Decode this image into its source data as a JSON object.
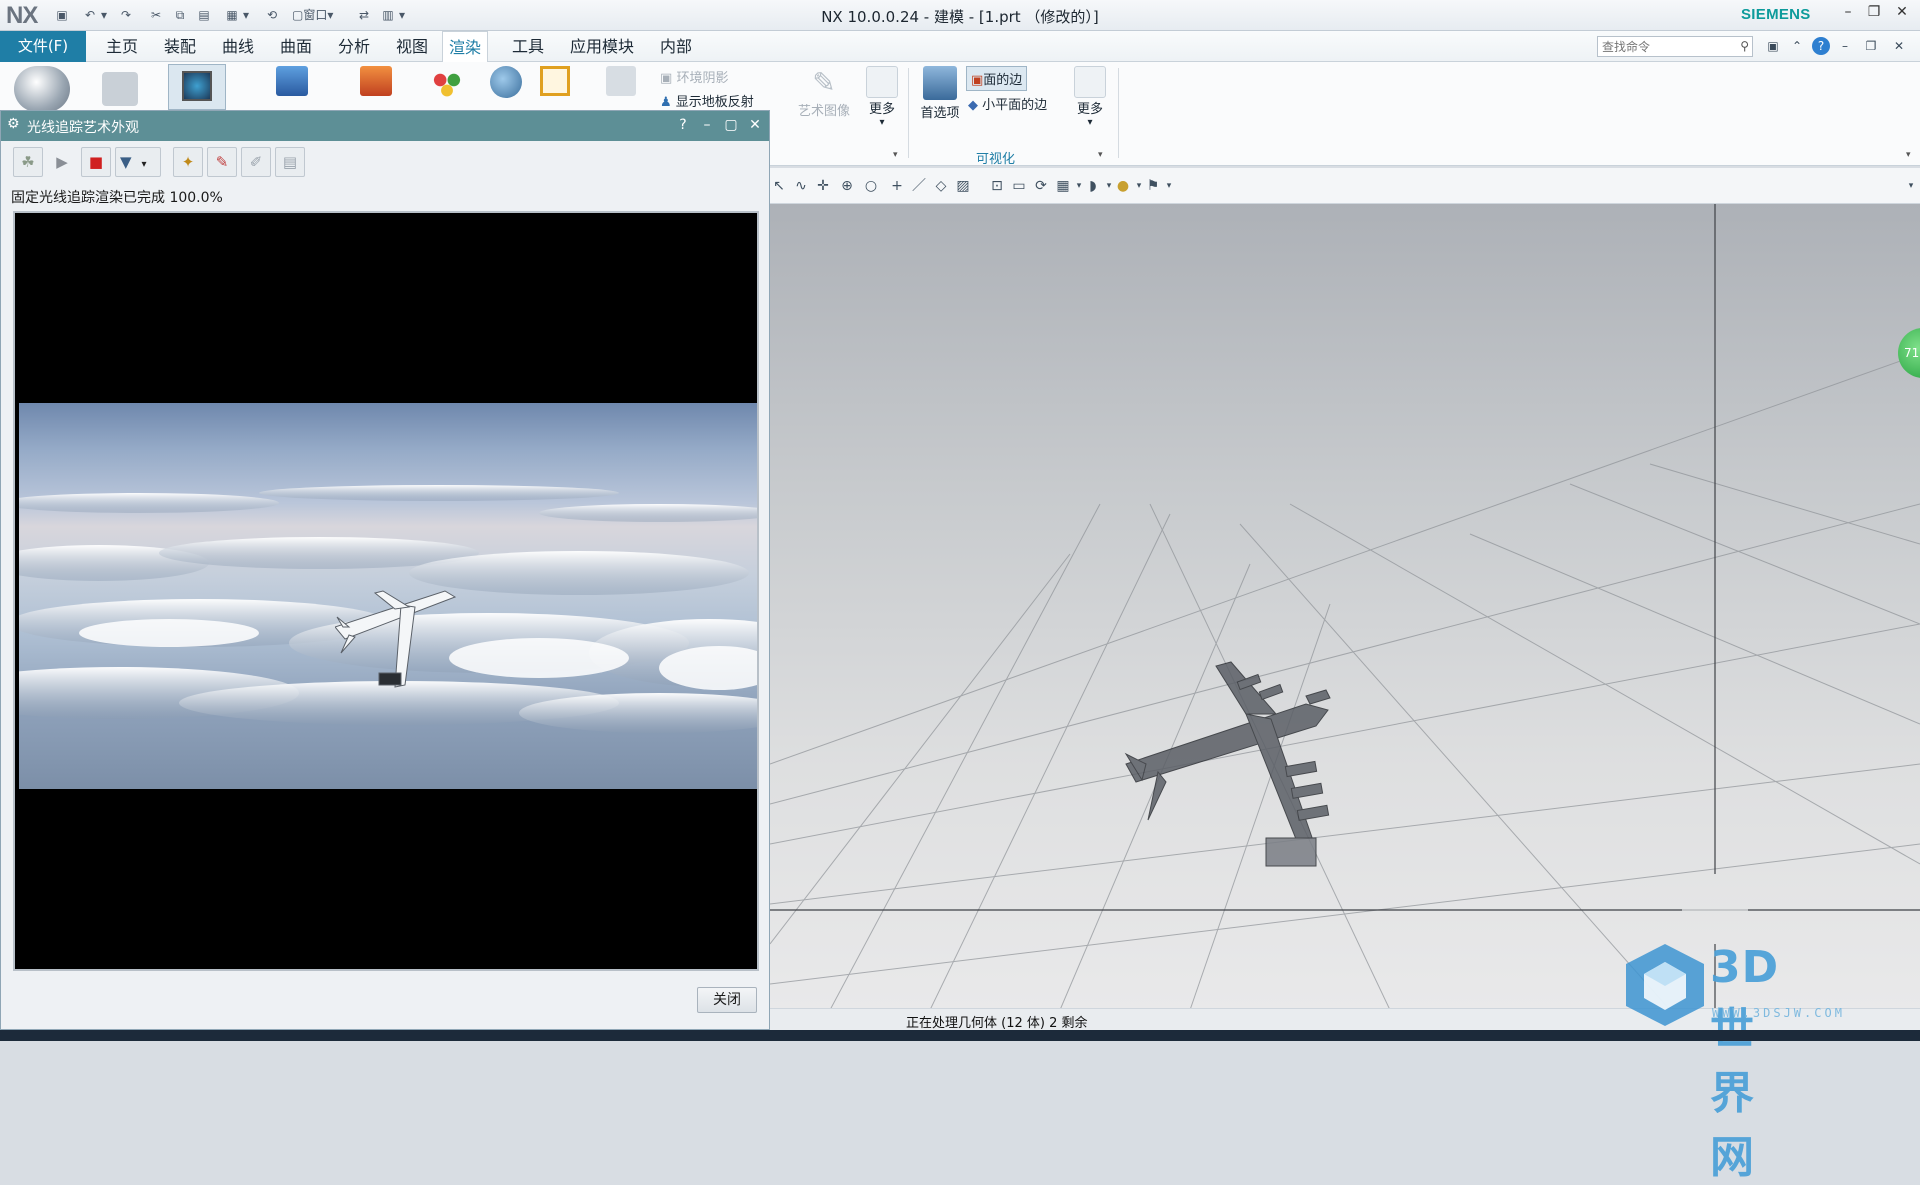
{
  "app": {
    "logo": "NX",
    "window_title": "NX 10.0.0.24 - 建模 - [1.prt （修改的）]",
    "brand": "SIEMENS",
    "window_menu": "窗口"
  },
  "menu": {
    "file": "文件(F)",
    "tabs": [
      "主页",
      "装配",
      "曲线",
      "曲面",
      "分析",
      "视图",
      "渲染",
      "工具",
      "应用模块",
      "内部"
    ],
    "active_tab": "渲染",
    "search_placeholder": "查找命令"
  },
  "ribbon": {
    "small_items": [
      {
        "label": "环境阴影",
        "enabled": false
      },
      {
        "label": "显示地板反射",
        "enabled": true
      }
    ],
    "art_image": "艺术图像",
    "more_1": "更多",
    "preferences": "首选项",
    "face_edges": "面的边",
    "facet_edges": "小平面的边",
    "more_2": "更多",
    "group_visualization": "可视化"
  },
  "dialog": {
    "title": "光线追踪艺术外观",
    "status": "固定光线追踪渲染已完成 100.0%",
    "help": "?",
    "close_label": "关闭"
  },
  "statusbar": {
    "text": "正在处理几何体 (12 体)  2 剩余"
  },
  "graphics": {
    "badge": "71"
  },
  "watermark": {
    "text": "3D世界网",
    "url": "WWW.3DSJW.COM"
  },
  "colors": {
    "accent": "#1f7ea6",
    "dialog_title": "#5d8f96",
    "brand": "#0d9b9b"
  }
}
